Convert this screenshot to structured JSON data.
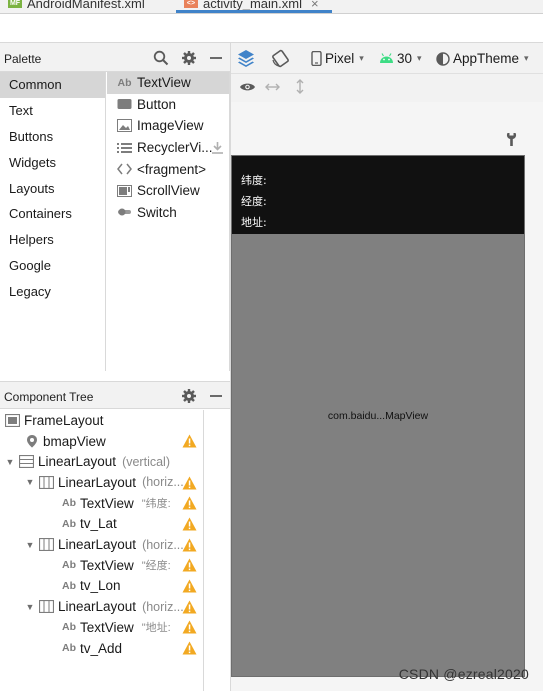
{
  "tabs": [
    {
      "label": "AndroidManifest.xml",
      "badge": "MF"
    },
    {
      "label": "activity_main.xml",
      "badge": "<>"
    }
  ],
  "palette": {
    "title": "Palette",
    "categories": [
      "Common",
      "Text",
      "Buttons",
      "Widgets",
      "Layouts",
      "Containers",
      "Helpers",
      "Google",
      "Legacy"
    ],
    "selected_category": "Common",
    "widgets": [
      {
        "label": "TextView",
        "icon": "textview-icon"
      },
      {
        "label": "Button",
        "icon": "button-icon"
      },
      {
        "label": "ImageView",
        "icon": "imageview-icon"
      },
      {
        "label": "RecyclerVi...",
        "icon": "recyclerview-icon"
      },
      {
        "label": "<fragment>",
        "icon": "fragment-icon"
      },
      {
        "label": "ScrollView",
        "icon": "scrollview-icon"
      },
      {
        "label": "Switch",
        "icon": "switch-icon"
      }
    ]
  },
  "component_tree": {
    "title": "Component Tree",
    "nodes": [
      {
        "label": "FrameLayout",
        "sub": "",
        "attr": ""
      },
      {
        "label": "bmapView",
        "sub": "",
        "attr": ""
      },
      {
        "label": "LinearLayout",
        "sub": "(vertical)",
        "attr": ""
      },
      {
        "label": "LinearLayout",
        "sub": "(horiz...",
        "attr": ""
      },
      {
        "label": "TextView",
        "sub": "",
        "attr": "\"纬度:"
      },
      {
        "label": "tv_Lat",
        "sub": "",
        "attr": ""
      },
      {
        "label": "LinearLayout",
        "sub": "(horiz...",
        "attr": ""
      },
      {
        "label": "TextView",
        "sub": "",
        "attr": "\"经度:"
      },
      {
        "label": "tv_Lon",
        "sub": "",
        "attr": ""
      },
      {
        "label": "LinearLayout",
        "sub": "(horiz...",
        "attr": ""
      },
      {
        "label": "TextView",
        "sub": "",
        "attr": "\"地址:"
      },
      {
        "label": "tv_Add",
        "sub": "",
        "attr": ""
      }
    ]
  },
  "toolbar": {
    "device": "Pixel",
    "api_level": "30",
    "theme": "AppTheme"
  },
  "preview": {
    "lat_label": "纬度:",
    "lon_label": "经度:",
    "addr_label": "地址:",
    "map_label": "com.baidu...MapView"
  },
  "watermark": "CSDN @ezreal2020",
  "colors": {
    "accent": "#4083c9",
    "warning": "#f2a922",
    "android_green": "#3ddc84",
    "map_gray": "#808080"
  }
}
